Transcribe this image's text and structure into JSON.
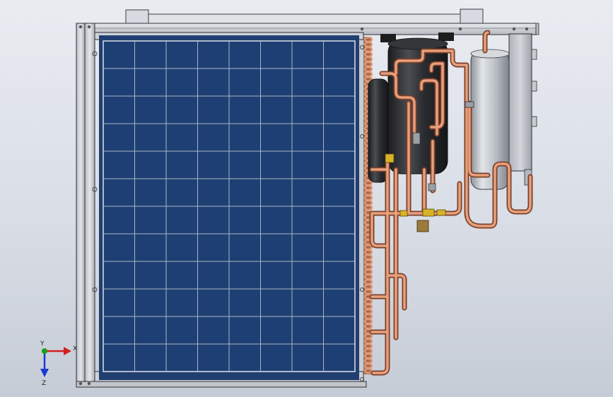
{
  "triad": {
    "x_label": "X",
    "y_label": "Y",
    "z_label": "Z",
    "x_color": "#d42020",
    "y_color": "#1aa01a",
    "z_color": "#1a3ad4"
  },
  "colors": {
    "panel_blue": "#1e3f73",
    "frame_gray": "#c9ccd2",
    "copper": "#d98a66",
    "tank_dark": "#2b2d31",
    "tank_light": "#c8ccd1",
    "brass": "#d8b325"
  }
}
